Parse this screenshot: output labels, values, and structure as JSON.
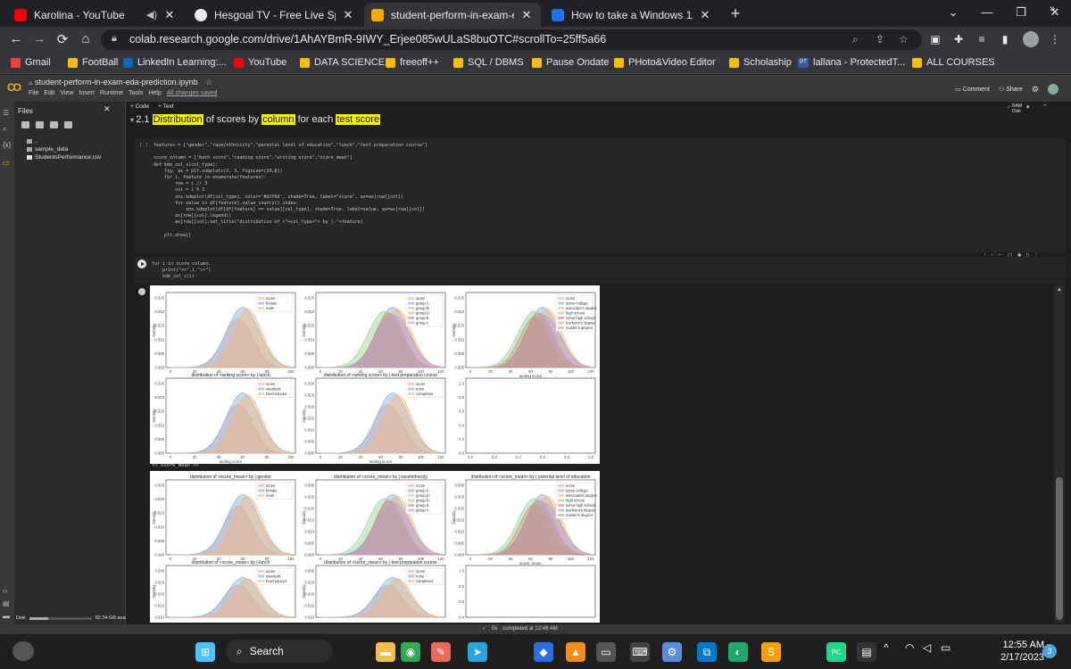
{
  "browser": {
    "tabs": [
      {
        "title": "Karolina - YouTube",
        "favicon_color": "#ff0000",
        "sound": true
      },
      {
        "title": "Hesgoal TV - Free Live Sports Stre",
        "favicon_color": "#e8eaed"
      },
      {
        "title": "student-perform-in-exam-eda-p",
        "favicon_color": "#f9ab00",
        "active": true
      },
      {
        "title": "How to take a Windows 11 screen",
        "favicon_color": "#1a73e8"
      }
    ],
    "new_tab_symbol": "+",
    "window_controls": {
      "dropdown": "⌄",
      "minimize": "—",
      "restore": "❐",
      "close": "✕"
    },
    "nav": {
      "back": "←",
      "forward": "→",
      "reload": "⟳",
      "home": "⌂"
    },
    "url": "colab.research.google.com/drive/1AhAYBmR-9IWY_Erjee085wULaS8buOTC#scrollTo=25ff5a66",
    "bookmarks": [
      {
        "label": "Gmail",
        "color": "#ea4335"
      },
      {
        "label": "FootBall",
        "color": "#fbbc04"
      },
      {
        "label": "LinkedIn Learning:...",
        "color": "#0a66c2"
      },
      {
        "label": "YouTube",
        "color": "#ff0000"
      },
      {
        "label": "DATA SCIENCE",
        "color": "#fbbc04"
      },
      {
        "label": "freeoff++",
        "color": "#fbbc04"
      },
      {
        "label": "SQL / DBMS",
        "color": "#fbbc04"
      },
      {
        "label": "Pause Ondate",
        "color": "#fbbc04"
      },
      {
        "label": "PHoto&Video Editor",
        "color": "#fbbc04"
      },
      {
        "label": "Scholaship",
        "color": "#fbbc04"
      },
      {
        "label": "lallana - ProtectedT...",
        "color": "#3b5998",
        "prefix": "PT"
      },
      {
        "label": "ALL COURSES",
        "color": "#fbbc04"
      }
    ],
    "bookmarks_more": "»"
  },
  "colab": {
    "logo": "CO",
    "notebook_title": "student-perform-in-exam-eda-prediction.ipynb",
    "menu": [
      "File",
      "Edit",
      "View",
      "Insert",
      "Runtime",
      "Tools",
      "Help"
    ],
    "saved_status": "All changes saved",
    "header_right": {
      "comment": "Comment",
      "share": "Share"
    },
    "sidebar": {
      "title": "Files",
      "close": "✕"
    },
    "files": [
      {
        "name": ".."
      },
      {
        "name": "sample_data"
      },
      {
        "name": "StudentsPerformance.csv"
      }
    ],
    "disk": {
      "label": "Disk",
      "available": "82.34 GB available",
      "used_fraction": 0.3
    },
    "toolbar": {
      "code": "+ Code",
      "text": "+ Text"
    },
    "ram_disk": {
      "ram": "RAM",
      "disk": "Disk"
    },
    "section_heading": {
      "num": "2.1",
      "parts": [
        "Distribution",
        " of scores by ",
        "column",
        " for each ",
        "test score"
      ]
    },
    "code_cell_1": {
      "prompt": "[ ]",
      "lines": [
        "features = [\"gender\",\"race/ethnicity\",\"parental level of education\",\"lunch\",\"test preparation course\"]",
        "",
        "score_column = [\"math score\",\"reading score\",\"writing score\",\"score_mean\"]",
        "def kde_col_s(col_type):",
        "    fig, ax = plt.subplots(2, 3, figsize=(20,8))",
        "    for i, feature in enumerate(features):",
        "        row = i // 3",
        "        col = i % 3",
        "        sns.kdeplot(df[col_type], color='#d3f6d', shade=True, label=\"score\", ax=ax[row][col])",
        "        for value in df[feature].value_counts().index:",
        "            sns.kdeplot(df[df[feature] == value][col_type], shade=True, label=value, ax=ax[row][col])",
        "        ax[row][col].legend()",
        "        ax[row][col].set_title(\"distribution of <\"+col_type+\"> by |-\"+feature)",
        "",
        "    plt.show()"
      ]
    },
    "code_cell_2": {
      "lines": [
        "for i in score_column:",
        "    print(\"<<\",i,\">>\")",
        "    kde_col_s(i)"
      ]
    },
    "output_label": "<< score_mean >>",
    "cell_tools": [
      "↑",
      "↓",
      "⇔",
      "▢",
      "✱",
      "▯",
      "⋮"
    ],
    "status": {
      "check": "✓",
      "time": "0s",
      "text": "completed at 12:46 AM"
    }
  },
  "plots": {
    "panels": [
      {
        "id": "w-race",
        "title": "",
        "ylabel": "Density",
        "xlabel": "",
        "xticks": [
          0,
          20,
          40,
          60,
          80,
          100
        ],
        "yticks": [
          "0.000",
          "0.005",
          "0.010",
          "0.015",
          "0.020",
          "0.025"
        ],
        "legend": [
          "score",
          "female",
          "male"
        ],
        "series": [
          "#f7a6a6",
          "#7faed6",
          "#f6b37a"
        ]
      },
      {
        "id": "w-eth",
        "title": "",
        "ylabel": "Density",
        "xlabel": "",
        "xticks": [
          0,
          20,
          40,
          60,
          80,
          100,
          120
        ],
        "yticks": [
          "0.000",
          "0.005",
          "0.010",
          "0.015",
          "0.020",
          "0.025"
        ],
        "legend": [
          "score",
          "group C",
          "group B",
          "group D",
          "group E",
          "group A"
        ],
        "series": [
          "#f7a6a6",
          "#7faed6",
          "#f6b37a",
          "#8fd18f",
          "#e08080",
          "#b9a0d8"
        ]
      },
      {
        "id": "w-edu",
        "title": "",
        "ylabel": "Density",
        "xlabel": "writing score",
        "xticks": [
          0,
          20,
          40,
          60,
          80,
          100,
          120
        ],
        "yticks": [
          "0.000",
          "0.005",
          "0.010",
          "0.015",
          "0.020",
          "0.025"
        ],
        "legend": [
          "score",
          "some college",
          "associate's degree",
          "high school",
          "some high school",
          "bachelor's degree",
          "master's degree"
        ],
        "series": [
          "#f7a6a6",
          "#7faed6",
          "#f6b37a",
          "#8fd18f",
          "#e08080",
          "#b9a0d8",
          "#c69a82"
        ]
      },
      {
        "id": "w-lunch",
        "title": "distribution of <writing score> by |-lunch",
        "ylabel": "Density",
        "xlabel": "writing score",
        "xticks": [
          0,
          20,
          40,
          60,
          80,
          100
        ],
        "yticks": [
          "0.000",
          "0.005",
          "0.010",
          "0.015",
          "0.020",
          "0.025"
        ],
        "legend": [
          "score",
          "standard",
          "free/reduced"
        ],
        "series": [
          "#f7a6a6",
          "#7faed6",
          "#f6b37a"
        ]
      },
      {
        "id": "w-prep",
        "title": "distribution of <writing score> by |-test preparation course",
        "ylabel": "Density",
        "xlabel": "writing score",
        "xticks": [
          0,
          20,
          40,
          60,
          80,
          100,
          120
        ],
        "yticks": [
          "0.000",
          "0.005",
          "0.010",
          "0.015",
          "0.020",
          "0.025",
          "0.030"
        ],
        "legend": [
          "score",
          "none",
          "completed"
        ],
        "series": [
          "#f7a6a6",
          "#7faed6",
          "#f6b37a"
        ]
      },
      {
        "id": "w-empty",
        "title": "",
        "ylabel": "",
        "xlabel": "",
        "xticks": [
          "0.0",
          "0.2",
          "0.4",
          "0.6",
          "0.8",
          "1.0"
        ],
        "yticks": [
          "0.0",
          "0.2",
          "0.4",
          "0.6",
          "0.8",
          "1.0"
        ],
        "legend": [],
        "series": []
      },
      {
        "id": "m-gender",
        "title": "distribution of <score_mean> by |-gender",
        "ylabel": "Density",
        "xlabel": "",
        "xticks": [
          0,
          20,
          40,
          60,
          80,
          100
        ],
        "yticks": [
          "0.000",
          "0.005",
          "0.010",
          "0.015",
          "0.020",
          "0.025"
        ],
        "legend": [
          "score",
          "female",
          "male"
        ],
        "series": [
          "#f7a6a6",
          "#7faed6",
          "#f6b37a"
        ]
      },
      {
        "id": "m-eth",
        "title": "distribution of <score_mean> by |-race/ethnicity",
        "ylabel": "Density",
        "xlabel": "",
        "xticks": [
          0,
          20,
          40,
          60,
          80,
          100,
          120
        ],
        "yticks": [
          "0.000",
          "0.005",
          "0.010",
          "0.015",
          "0.020",
          "0.025",
          "0.030"
        ],
        "legend": [
          "score",
          "group C",
          "group D",
          "group B",
          "group E",
          "group A"
        ],
        "series": [
          "#f7a6a6",
          "#7faed6",
          "#f6b37a",
          "#8fd18f",
          "#e08080",
          "#b9a0d8"
        ]
      },
      {
        "id": "m-edu",
        "title": "distribution of <score_mean> by |-parental level of education",
        "ylabel": "Density",
        "xlabel": "score_mean",
        "xticks": [
          0,
          20,
          40,
          60,
          80,
          100,
          120
        ],
        "yticks": [
          "0.000",
          "0.005",
          "0.010",
          "0.015",
          "0.020",
          "0.025",
          "0.030"
        ],
        "legend": [
          "score",
          "some college",
          "associate's degree",
          "high school",
          "some high school",
          "bachelor's degree",
          "master's degree"
        ],
        "series": [
          "#f7a6a6",
          "#7faed6",
          "#f6b37a",
          "#8fd18f",
          "#e08080",
          "#b9a0d8",
          "#c69a82"
        ]
      },
      {
        "id": "m-lunch",
        "title": "distribution of <score_mean> by |-lunch",
        "ylabel": "Density",
        "xlabel": "",
        "xticks": [],
        "yticks": [
          "0.010",
          "0.015",
          "0.020",
          "0.025",
          "0.030"
        ],
        "legend": [
          "score",
          "standard",
          "free/reduced"
        ],
        "series": [
          "#f7a6a6",
          "#7faed6",
          "#f6b37a"
        ]
      },
      {
        "id": "m-prep",
        "title": "distribution of <score_mean> by |-test preparation course",
        "ylabel": "Density",
        "xlabel": "",
        "xticks": [],
        "yticks": [
          "0.010",
          "0.015",
          "0.020",
          "0.025",
          "0.030"
        ],
        "legend": [
          "score",
          "none",
          "completed"
        ],
        "series": [
          "#f7a6a6",
          "#7faed6",
          "#f6b37a"
        ]
      },
      {
        "id": "m-empty",
        "title": "",
        "ylabel": "",
        "xlabel": "",
        "xticks": [],
        "yticks": [
          "0.4",
          "0.6",
          "0.8",
          "1.0"
        ],
        "legend": [],
        "series": []
      }
    ]
  },
  "taskbar": {
    "search_label": "Search",
    "apps": [
      {
        "name": "windows-start",
        "color": "#4cc2ff",
        "glyph": "⊞"
      },
      {
        "name": "file-explorer",
        "color": "#f0c04a",
        "glyph": "▬"
      },
      {
        "name": "chrome",
        "color": "#34a853",
        "glyph": "◉"
      },
      {
        "name": "paint",
        "color": "#e86a5a",
        "glyph": "✎"
      },
      {
        "name": "telegram",
        "color": "#2aa4e0",
        "glyph": "➤"
      },
      {
        "name": "app-blue",
        "color": "#2b6fe0",
        "glyph": "◆"
      },
      {
        "name": "vlc",
        "color": "#f48c1b",
        "glyph": "▲"
      },
      {
        "name": "terminal",
        "color": "#555555",
        "glyph": "▭"
      },
      {
        "name": "code-editor",
        "color": "#444444",
        "glyph": "⌨"
      },
      {
        "name": "settings",
        "color": "#5a8ddb",
        "glyph": "⚙"
      },
      {
        "name": "vs-code",
        "color": "#007acc",
        "glyph": "⧉"
      },
      {
        "name": "edge",
        "color": "#1fa86a",
        "glyph": "◐"
      },
      {
        "name": "sublime",
        "color": "#f59e0b",
        "glyph": "S"
      },
      {
        "name": "pycharm",
        "color": "#21d789",
        "glyph": "PC"
      },
      {
        "name": "app-dark",
        "color": "#333333",
        "glyph": "▤"
      }
    ],
    "tray": {
      "chevron": "^",
      "wifi": "◠",
      "volume": "◁",
      "battery": "▭"
    },
    "clock": {
      "time": "12:55 AM",
      "date": "2/17/2023"
    },
    "notifications": "3"
  }
}
